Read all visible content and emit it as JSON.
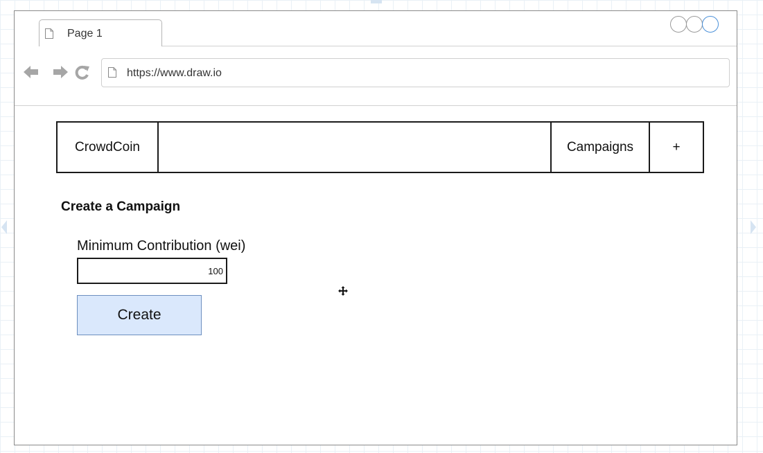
{
  "tab": {
    "title": "Page 1"
  },
  "address_bar": {
    "url": "https://www.draw.io"
  },
  "navbar": {
    "brand": "CrowdCoin",
    "campaigns": "Campaigns",
    "add": "+"
  },
  "form": {
    "heading": "Create a Campaign",
    "label": "Minimum Contribution (wei)",
    "value": "100",
    "submit_label": "Create"
  },
  "icons": [
    "page-icon",
    "back-arrow-icon",
    "forward-arrow-icon",
    "reload-icon",
    "window-control-icon",
    "move-cursor-icon"
  ],
  "colors": {
    "button_fill": "#dae8fc",
    "button_border": "#6c8ebf",
    "accent_circle": "#4a90d9",
    "grid": "#e9f0f6"
  }
}
